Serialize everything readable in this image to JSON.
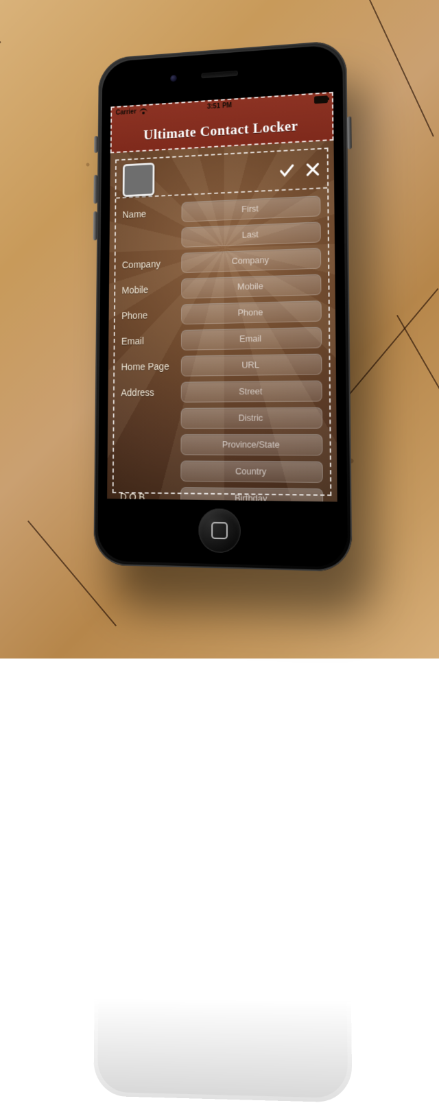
{
  "status": {
    "carrier": "Carrier",
    "time": "3:51 PM"
  },
  "header": {
    "title": "Ultimate Contact Locker"
  },
  "form": {
    "name_label": "Name",
    "first_ph": "First",
    "last_ph": "Last",
    "company_label": "Company",
    "company_ph": "Company",
    "mobile_label": "Mobile",
    "mobile_ph": "Mobile",
    "phone_label": "Phone",
    "phone_ph": "Phone",
    "email_label": "Email",
    "email_ph": "Email",
    "homepage_label": "Home Page",
    "homepage_ph": "URL",
    "address_label": "Address",
    "street_ph": "Street",
    "district_ph": "Distric",
    "province_ph": "Province/State",
    "country_ph": "Country",
    "dob_label": "D.O.B",
    "dob_ph": "Birthday"
  }
}
